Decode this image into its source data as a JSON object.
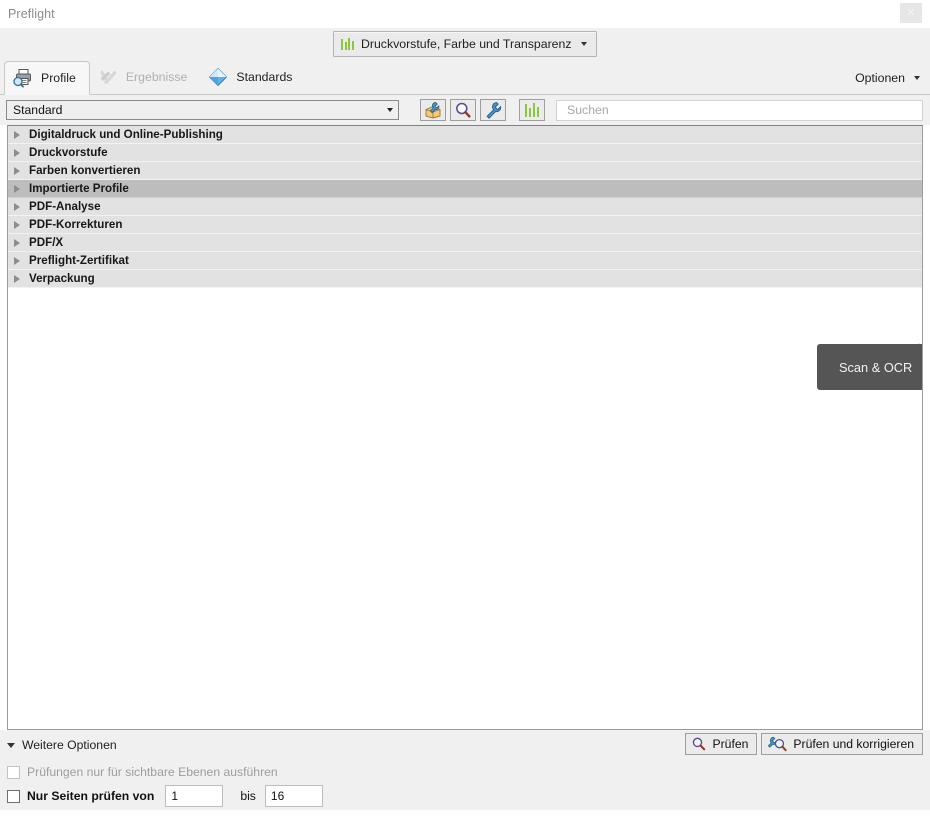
{
  "window": {
    "title": "Preflight",
    "close_label": "✕"
  },
  "modebar": {
    "button_label": "Druckvorstufe, Farbe und Transparenz",
    "icon": "bar-chart-icon",
    "caret": "chevron-down-icon"
  },
  "tabs": [
    {
      "label": "Profile",
      "icon": "printer-magnifier-icon",
      "state": "active"
    },
    {
      "label": "Ergebnisse",
      "icon": "crossed-check-icon",
      "state": "disabled"
    },
    {
      "label": "Standards",
      "icon": "blue-diamond-icon",
      "state": "normal"
    }
  ],
  "options_menu": {
    "label": "Optionen",
    "caret": "chevron-down-icon"
  },
  "toolbar": {
    "profile_select_value": "Standard",
    "buttons": [
      {
        "name": "edit-profile-button",
        "icon": "wrench-package-icon"
      },
      {
        "name": "inspect-button",
        "icon": "magnifier-icon"
      },
      {
        "name": "fixup-button",
        "icon": "wrench-icon"
      },
      {
        "name": "chart-button",
        "icon": "bar-chart-icon"
      }
    ],
    "search_placeholder": "Suchen",
    "search_value": ""
  },
  "profile_list": [
    {
      "label": "Digitaldruck und Online-Publishing",
      "selected": false
    },
    {
      "label": "Druckvorstufe",
      "selected": false
    },
    {
      "label": "Farben konvertieren",
      "selected": false
    },
    {
      "label": "Importierte Profile",
      "selected": true
    },
    {
      "label": "PDF-Analyse",
      "selected": false
    },
    {
      "label": "PDF-Korrekturen",
      "selected": false
    },
    {
      "label": "PDF/X",
      "selected": false
    },
    {
      "label": "Preflight-Zertifikat",
      "selected": false
    },
    {
      "label": "Verpackung",
      "selected": false
    }
  ],
  "tooltip": {
    "text": "Scan & OCR"
  },
  "bottom": {
    "more_options_label": "Weitere Optionen",
    "checkbox_visible_layers": {
      "label": "Prüfungen nur für sichtbare Ebenen ausführen",
      "checked": false,
      "disabled": true
    },
    "checkbox_page_range": {
      "label": "Nur Seiten prüfen von",
      "checked": false
    },
    "page_from_value": "1",
    "page_to_label": "bis",
    "page_to_value": "16",
    "check_button_label": "Prüfen",
    "check_fix_button_label": "Prüfen und korrigieren"
  },
  "colors": {
    "accent_green": "#8cc63e",
    "tooltip_bg": "#555555",
    "selected_row": "#bdbdbd",
    "row_bg": "#e2e2e2",
    "chrome_bg": "#f0f0f0"
  }
}
